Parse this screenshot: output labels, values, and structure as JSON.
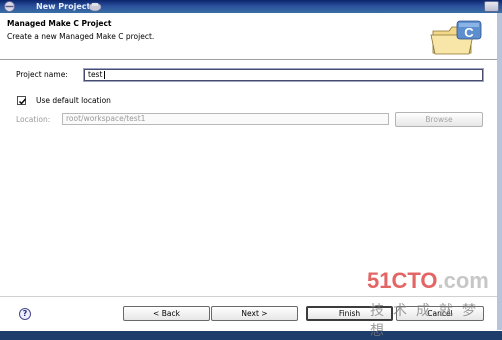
{
  "window": {
    "title": "New Project"
  },
  "banner": {
    "heading": "Managed Make C Project",
    "description": "Create a new Managed Make C project.",
    "wizard_icon_letter": "C"
  },
  "form": {
    "project_name_label": "Project name:",
    "project_name_value": "test",
    "use_default_label": "Use default location",
    "use_default_checked": true,
    "location_label": "Location:",
    "location_value": "root/workspace/test1",
    "browse_label": "Browse"
  },
  "buttons": {
    "help": "?",
    "back": "< Back",
    "next": "Next >",
    "finish": "Finish",
    "cancel": "Cancel"
  },
  "watermark": {
    "logo_num": "51CTO",
    "logo_dot": ".com",
    "subtitle": "技术成就梦想"
  },
  "colors": {
    "titlebar": "#0a246a",
    "watermark_red": "#e05050"
  }
}
